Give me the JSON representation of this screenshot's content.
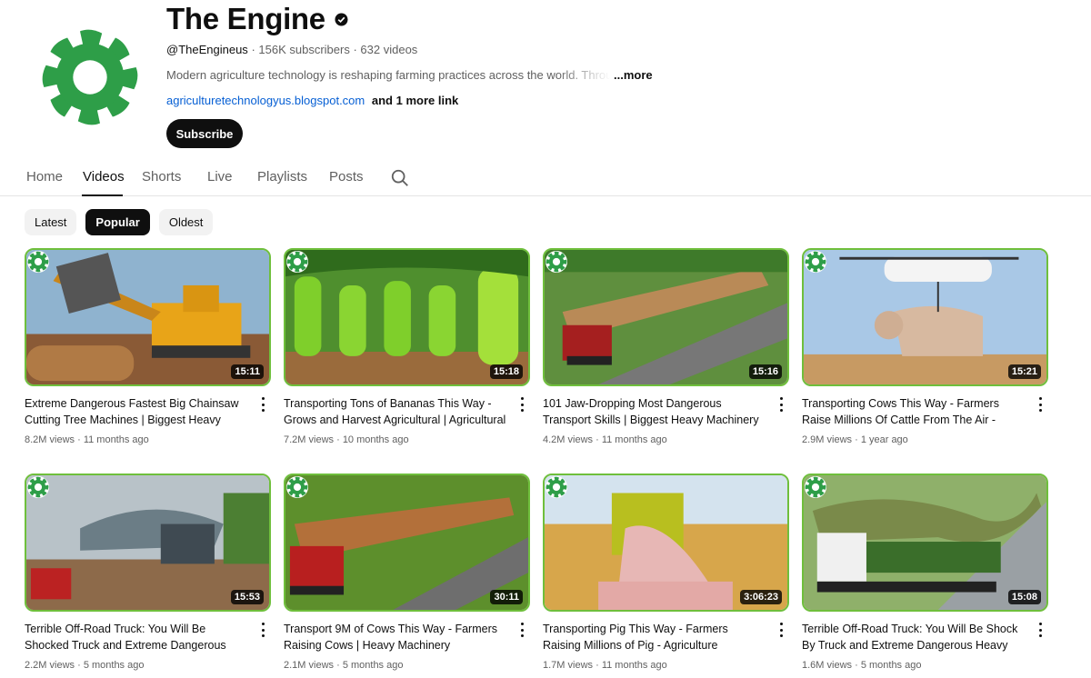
{
  "channel": {
    "name": "The Engine",
    "handle": "@TheEngineus",
    "subscribers": "156K subscribers",
    "videos": "632 videos",
    "description": "Modern agriculture technology is reshaping farming practices across the world. Through",
    "more_label": "...more",
    "link_url": "agriculturetechnologyus.blogspot.com",
    "link_more": "and 1 more link",
    "subscribe_label": "Subscribe",
    "brand_color": "#2e9e48",
    "verified_icon": "verified-check-icon"
  },
  "tabs": [
    {
      "label": "Home"
    },
    {
      "label": "Videos",
      "active": true
    },
    {
      "label": "Shorts"
    },
    {
      "label": "Live"
    },
    {
      "label": "Playlists"
    },
    {
      "label": "Posts"
    }
  ],
  "chips": [
    {
      "label": "Latest"
    },
    {
      "label": "Popular",
      "active": true
    },
    {
      "label": "Oldest"
    }
  ],
  "videos": [
    {
      "title": "Extreme Dangerous Fastest Big Chainsaw Cutting Tree Machines | Biggest Heavy Equipment",
      "views": "8.2M views",
      "age": "11 months ago",
      "duration": "15:11"
    },
    {
      "title": "Transporting Tons of Bananas This Way - Grows and Harvest Agricultural | Agricultural Technology",
      "views": "7.2M views",
      "age": "10 months ago",
      "duration": "15:18"
    },
    {
      "title": "101 Jaw-Dropping Most Dangerous Transport Skills | Biggest Heavy Machinery Equipment",
      "views": "4.2M views",
      "age": "11 months ago",
      "duration": "15:16"
    },
    {
      "title": "Transporting Cows This Way - Farmers Raise Millions Of Cattle From The Air - Agricultural Technology",
      "views": "2.9M views",
      "age": "1 year ago",
      "duration": "15:21"
    },
    {
      "title": "Terrible Off-Road Truck: You Will Be Shocked Truck and Extreme Dangerous Driving",
      "views": "2.2M views",
      "age": "5 months ago",
      "duration": "15:53"
    },
    {
      "title": "Transport 9M of Cows This Way - Farmers Raising Cows | Heavy Machinery",
      "views": "2.1M views",
      "age": "5 months ago",
      "duration": "30:11"
    },
    {
      "title": "Transporting Pig This Way - Farmers Raising Millions of Pig - Agriculture Technology",
      "views": "1.7M views",
      "age": "11 months ago",
      "duration": "3:06:23"
    },
    {
      "title": "Terrible Off-Road Truck: You Will Be Shock By Truck and Extreme Dangerous Heavy Equipment",
      "views": "1.6M views",
      "age": "5 months ago",
      "duration": "15:08"
    }
  ]
}
